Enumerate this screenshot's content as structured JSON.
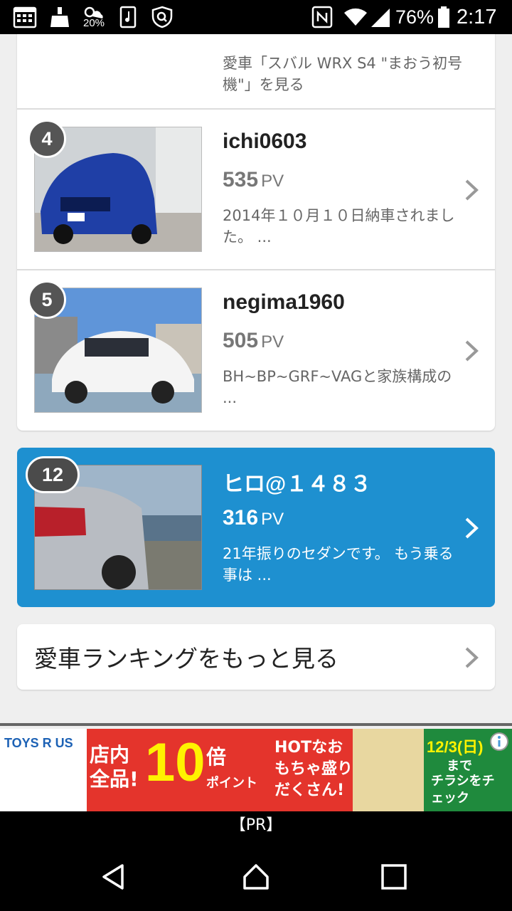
{
  "status_bar": {
    "weather_temp": "20%",
    "battery": "76%",
    "time": "2:17",
    "icons": [
      "calendar-icon",
      "cleaner-icon",
      "weather-icon",
      "music-file-icon",
      "shield-icon",
      "nfc-icon",
      "wifi-icon",
      "signal-icon",
      "battery-icon"
    ]
  },
  "previous_entry": {
    "desc": "愛車「スバル WRX S4 \"まおう初号機\"」を見る"
  },
  "ranking": [
    {
      "rank": "4",
      "user": "ichi0603",
      "pv": "535",
      "pv_unit": "PV",
      "desc": "2014年１０月１０日納車されました。 ..."
    },
    {
      "rank": "5",
      "user": "negima1960",
      "pv": "505",
      "pv_unit": "PV",
      "desc": "BH~BP~GRF~VAGと家族構成の ..."
    }
  ],
  "my_entry": {
    "rank": "12",
    "user": "ヒロ@１４８３",
    "pv": "316",
    "pv_unit": "PV",
    "desc": "21年振りのセダンです。 もう乗る事は ..."
  },
  "more_link": {
    "label": "愛車ランキングをもっと見る"
  },
  "ad": {
    "brand": "TOYS R US",
    "text_store": "店内全品!",
    "text_10x": "10",
    "text_bai": "倍",
    "text_point": "ポイント",
    "text_hot": "HOTなおもちゃ盛りだくさん!",
    "text_date": "12/3(日)",
    "text_made": "まで",
    "text_check": "チラシをチェック"
  },
  "pr_label": "【PR】",
  "colors": {
    "accent": "#1e90d0",
    "rank_badge": "#555555"
  }
}
